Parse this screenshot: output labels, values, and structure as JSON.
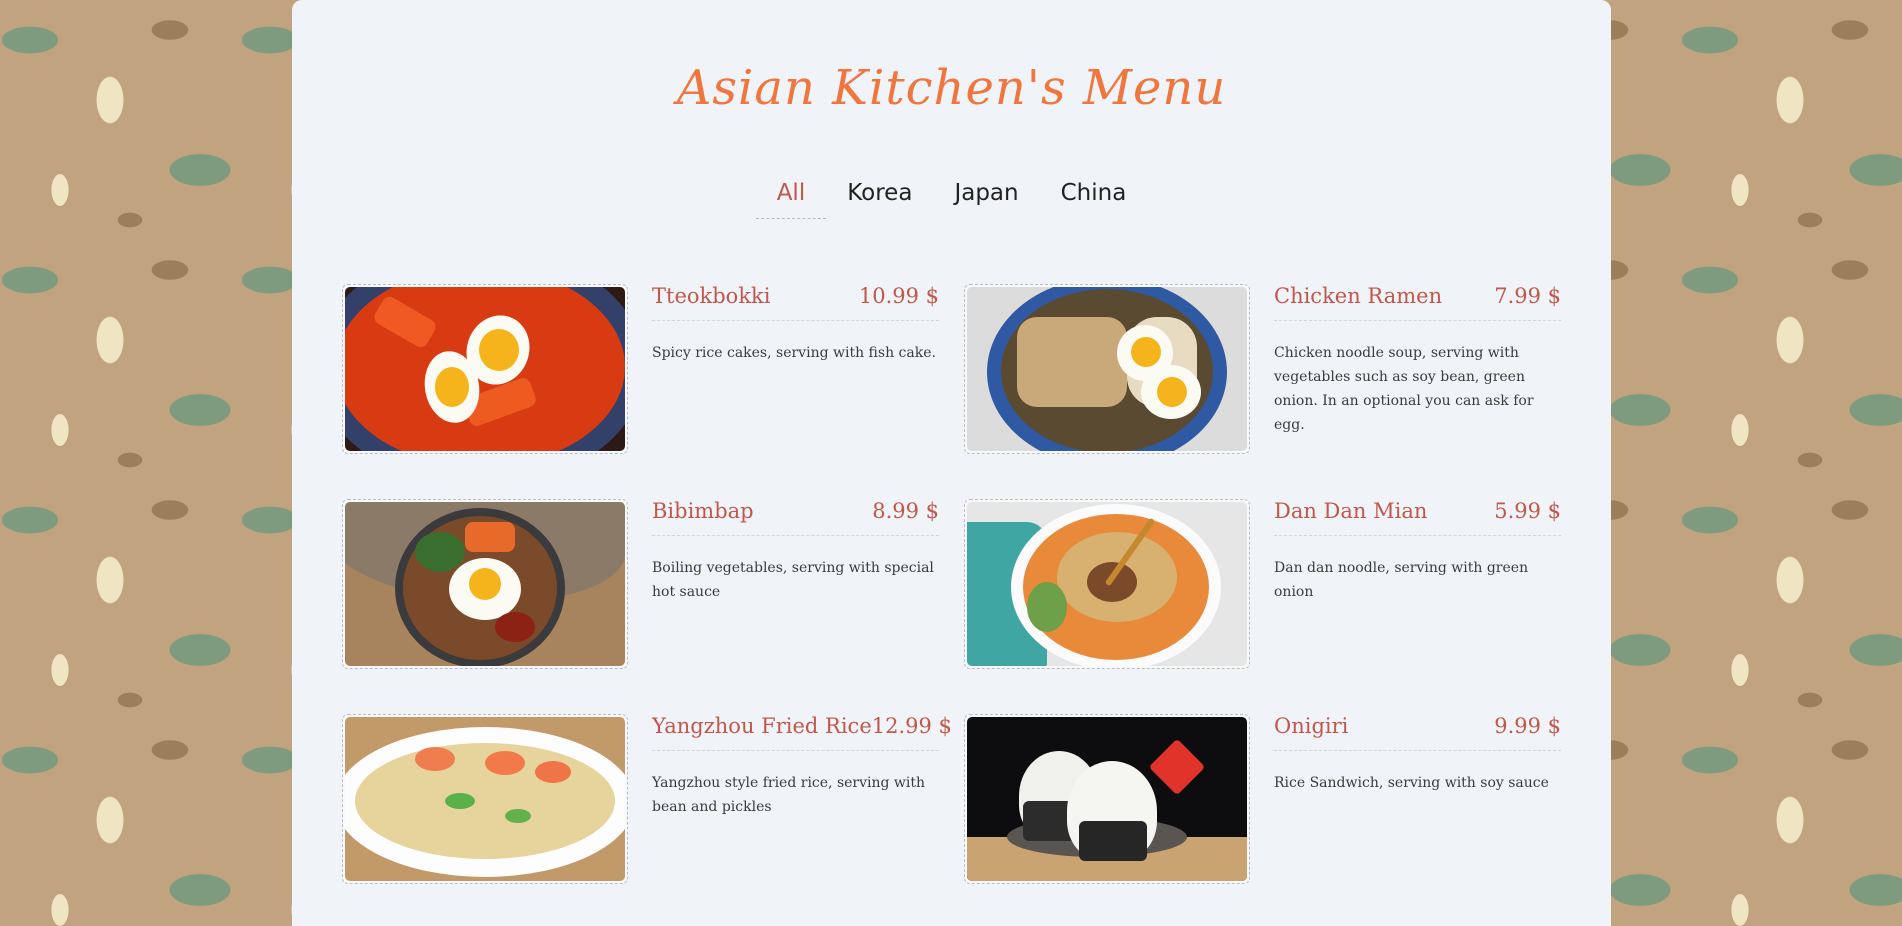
{
  "menu": {
    "title": "Asian Kitchen's Menu"
  },
  "tabs": [
    {
      "label": "All",
      "active": true
    },
    {
      "label": "Korea",
      "active": false
    },
    {
      "label": "Japan",
      "active": false
    },
    {
      "label": "China",
      "active": false
    }
  ],
  "items": [
    {
      "name": "Tteokbokki",
      "price": "10.99 $",
      "desc": "Spicy rice cakes, serving with fish cake.",
      "image": "tteokbokki-photo"
    },
    {
      "name": "Chicken Ramen",
      "price": "7.99 $",
      "desc": "Chicken noodle soup, serving with vegetables such as soy bean, green onion. In an optional you can ask for egg.",
      "image": "chicken-ramen-photo"
    },
    {
      "name": "Bibimbap",
      "price": "8.99 $",
      "desc": "Boiling vegetables, serving with special hot sauce",
      "image": "bibimbap-photo"
    },
    {
      "name": "Dan Dan Mian",
      "price": "5.99 $",
      "desc": "Dan dan noodle, serving with green onion",
      "image": "dan-dan-mian-photo"
    },
    {
      "name": "Yangzhou Fried Rice",
      "price": "12.99 $",
      "desc": "Yangzhou style fried rice, serving with bean and pickles",
      "image": "yangzhou-fried-rice-photo"
    },
    {
      "name": "Onigiri",
      "price": "9.99 $",
      "desc": "Rice Sandwich, serving with soy sauce",
      "image": "onigiri-photo"
    }
  ],
  "colors": {
    "accent": "#c0584b",
    "title": "#f0763e",
    "card": "#f0f3f7",
    "background": "#c1a47f"
  }
}
